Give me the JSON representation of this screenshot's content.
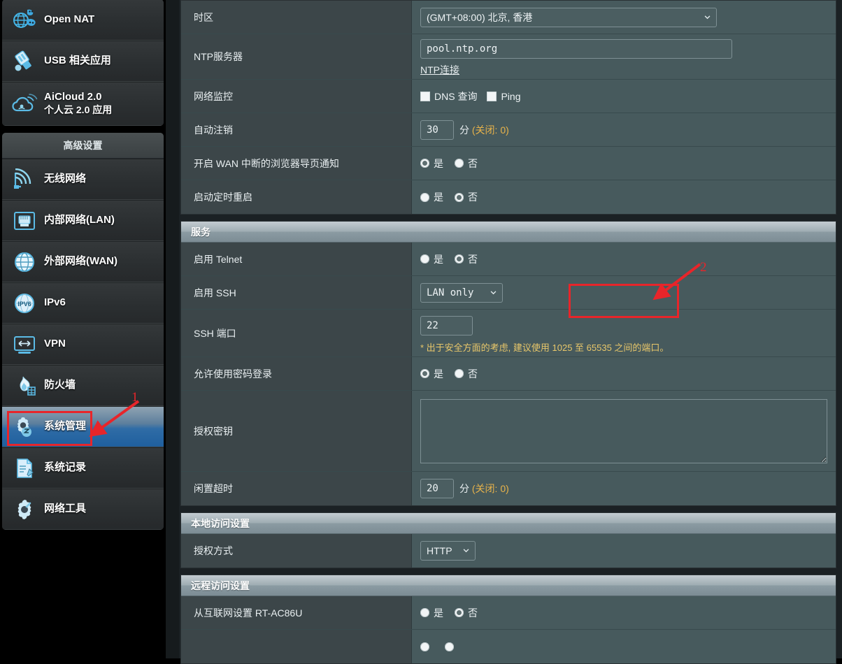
{
  "sidebar": {
    "top_items": [
      {
        "label": "Open NAT",
        "icon": "open-nat-icon",
        "selected": false
      },
      {
        "label": "USB 相关应用",
        "icon": "usb-icon",
        "selected": false
      },
      {
        "label": "AiCloud 2.0",
        "sub": "个人云 2.0 应用",
        "icon": "aicloud-icon",
        "selected": false
      }
    ],
    "advanced_header": "高级设置",
    "advanced_items": [
      {
        "label": "无线网络",
        "icon": "wireless-icon",
        "selected": false
      },
      {
        "label": "内部网络(LAN)",
        "icon": "lan-icon",
        "selected": false
      },
      {
        "label": "外部网络(WAN)",
        "icon": "wan-icon",
        "selected": false
      },
      {
        "label": "IPv6",
        "icon": "ipv6-icon",
        "selected": false
      },
      {
        "label": "VPN",
        "icon": "vpn-icon",
        "selected": false
      },
      {
        "label": "防火墙",
        "icon": "firewall-icon",
        "selected": false
      },
      {
        "label": "系统管理",
        "icon": "administration-icon",
        "selected": true
      },
      {
        "label": "系统记录",
        "icon": "system-log-icon",
        "selected": false
      },
      {
        "label": "网络工具",
        "icon": "network-tools-icon",
        "selected": false
      }
    ]
  },
  "annotations": [
    {
      "number": "1",
      "target": "系统管理",
      "color": "#e8252a"
    },
    {
      "number": "2",
      "target": "启用 SSH",
      "color": "#e8252a"
    }
  ],
  "main": {
    "system_rows": {
      "timezone": {
        "label": "时区",
        "value": "(GMT+08:00) 北京, 香港",
        "icon": "chevron-down-icon"
      },
      "ntp_server": {
        "label": "NTP服务器",
        "value": "pool.ntp.org",
        "link": "NTP连接"
      },
      "network_monitoring": {
        "label": "网络监控",
        "checkboxes": [
          {
            "label": "DNS 查询",
            "checked": false
          },
          {
            "label": "Ping",
            "checked": false
          }
        ]
      },
      "auto_logout": {
        "label": "自动注销",
        "value": "30",
        "unit": "分",
        "off_note": "(关闭: 0)"
      },
      "wan_notice": {
        "label": "开启 WAN 中断的浏览器导页通知",
        "options": [
          {
            "label": "是",
            "selected": true
          },
          {
            "label": "否",
            "selected": false
          }
        ]
      },
      "scheduled_reboot": {
        "label": "启动定时重启",
        "options": [
          {
            "label": "是",
            "selected": false
          },
          {
            "label": "否",
            "selected": true
          }
        ]
      }
    },
    "service_section": {
      "header": "服务",
      "telnet": {
        "label": "启用 Telnet",
        "options": [
          {
            "label": "是",
            "selected": false
          },
          {
            "label": "否",
            "selected": true
          }
        ]
      },
      "ssh": {
        "label": "启用 SSH",
        "value": "LAN only",
        "icon": "chevron-down-icon"
      },
      "ssh_port": {
        "label": "SSH 端口",
        "value": "22",
        "hint": "* 出于安全方面的考虑, 建议使用 1025 至 65535 之间的端口。"
      },
      "password_login": {
        "label": "允许使用密码登录",
        "options": [
          {
            "label": "是",
            "selected": true
          },
          {
            "label": "否",
            "selected": false
          }
        ]
      },
      "authorized_keys": {
        "label": "授权密钥",
        "value": ""
      },
      "idle_timeout": {
        "label": "闲置超时",
        "value": "20",
        "unit": "分",
        "off_note": "(关闭: 0)"
      }
    },
    "local_access_section": {
      "header": "本地访问设置",
      "auth_method": {
        "label": "授权方式",
        "value": "HTTP",
        "icon": "chevron-down-icon"
      }
    },
    "remote_access_section": {
      "header": "远程访问设置",
      "from_internet": {
        "label": "从互联网设置 RT-AC86U",
        "options": [
          {
            "label": "是",
            "selected": false
          },
          {
            "label": "否",
            "selected": true
          }
        ]
      },
      "partial_row": {
        "options": [
          {
            "label": "",
            "selected": false
          },
          {
            "label": "",
            "selected": false
          }
        ]
      }
    }
  },
  "colors": {
    "accent_red": "#e8252a",
    "panel_bg": "#475a5d",
    "label_bg": "#3c4649",
    "selected_nav": "#1f5f9e",
    "hint_yellow": "#e8c76a"
  }
}
